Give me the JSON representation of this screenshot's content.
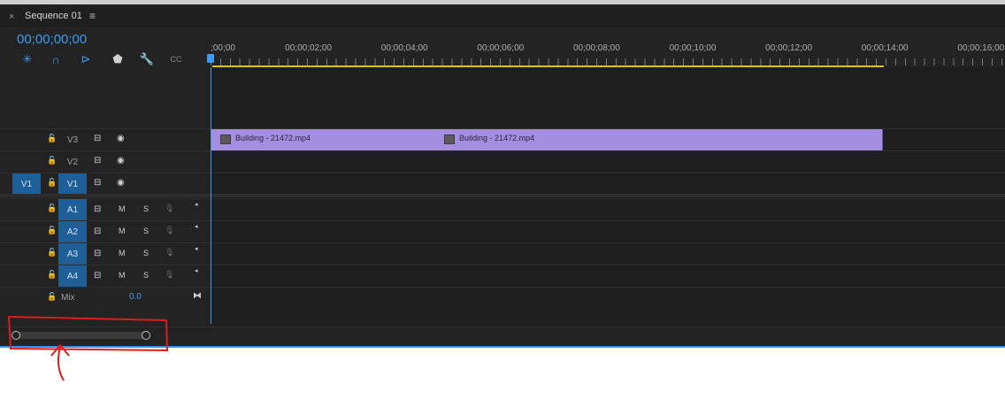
{
  "tab": {
    "close": "×",
    "title": "Sequence 01",
    "menu": "≡"
  },
  "timecode": "00;00;00;00",
  "toolbar": [
    {
      "name": "snap-insert-icon",
      "glyph": "✳",
      "color": "#3d9bf2"
    },
    {
      "name": "magnet-snap-icon",
      "glyph": "∩",
      "color": "#3d9bf2"
    },
    {
      "name": "linked-selection-icon",
      "glyph": "⊳",
      "color": "#3d9bf2"
    },
    {
      "name": "add-marker-icon",
      "glyph": "⬟",
      "color": "#cfcfcf"
    },
    {
      "name": "wrench-settings-icon",
      "glyph": "🔧",
      "color": "#cfcfcf"
    },
    {
      "name": "captions-icon",
      "glyph": "CC",
      "color": "#8a8a8a"
    }
  ],
  "ruler": {
    "labels": [
      ";00;00",
      "00;00;02;00",
      "00;00;04;00",
      "00;00;06;00",
      "00;00;08;00",
      "00;00;10;00",
      "00;00;12;00",
      "00;00;14;00",
      "00;00;16;00"
    ]
  },
  "tracks": {
    "video": [
      {
        "name": "V3",
        "active": false
      },
      {
        "name": "V2",
        "active": false
      },
      {
        "name": "V1",
        "active": true,
        "source": "V1"
      }
    ],
    "audio": [
      {
        "name": "A1",
        "m": "M",
        "s": "S"
      },
      {
        "name": "A2",
        "m": "M",
        "s": "S"
      },
      {
        "name": "A3",
        "m": "M",
        "s": "S"
      },
      {
        "name": "A4",
        "m": "M",
        "s": "S"
      }
    ],
    "mix": {
      "label": "Mix",
      "value": "0.0"
    }
  },
  "clips": [
    {
      "label": "Building - 21472.mp4",
      "start_sec": 0.0,
      "end_sec": 4.66
    },
    {
      "label": "Building - 21472.mp4",
      "start_sec": 4.66,
      "end_sec": 13.98
    }
  ],
  "colors": {
    "accent": "#3d9bf2",
    "clip": "#a48ee0",
    "annotation": "#e01b1b"
  }
}
